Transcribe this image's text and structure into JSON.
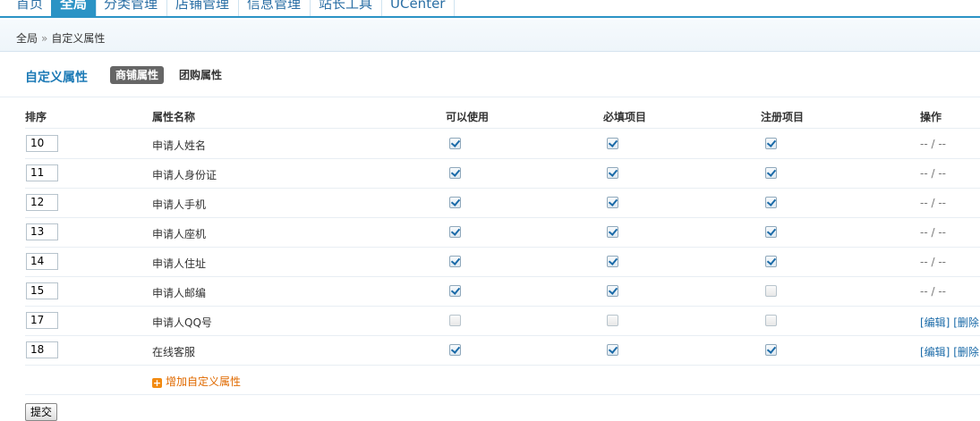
{
  "nav": {
    "tabs": [
      {
        "label": "首页"
      },
      {
        "label": "全局",
        "active": true
      },
      {
        "label": "分类管理"
      },
      {
        "label": "店铺管理"
      },
      {
        "label": "信息管理"
      },
      {
        "label": "站长工具"
      },
      {
        "label": "UCenter"
      }
    ]
  },
  "breadcrumb": {
    "root": "全局",
    "separator": "»",
    "current": "自定义属性"
  },
  "section": {
    "title": "自定义属性",
    "subtabs": [
      {
        "label": "商铺属性",
        "active": true
      },
      {
        "label": "团购属性"
      }
    ]
  },
  "table": {
    "headers": {
      "order": "排序",
      "name": "属性名称",
      "usable": "可以使用",
      "required": "必填项目",
      "register": "注册项目",
      "action": "操作"
    },
    "rows": [
      {
        "order": "10",
        "name": "申请人姓名",
        "usable": true,
        "required": true,
        "register": true,
        "action": "-- / --"
      },
      {
        "order": "11",
        "name": "申请人身份证",
        "usable": true,
        "required": true,
        "register": true,
        "action": "-- / --"
      },
      {
        "order": "12",
        "name": "申请人手机",
        "usable": true,
        "required": true,
        "register": true,
        "action": "-- / --"
      },
      {
        "order": "13",
        "name": "申请人座机",
        "usable": true,
        "required": true,
        "register": true,
        "action": "-- / --"
      },
      {
        "order": "14",
        "name": "申请人住址",
        "usable": true,
        "required": true,
        "register": true,
        "action": "-- / --"
      },
      {
        "order": "15",
        "name": "申请人邮编",
        "usable": true,
        "required": true,
        "register": false,
        "action": "-- / --"
      },
      {
        "order": "17",
        "name": "申请人QQ号",
        "usable": false,
        "required": false,
        "register": false,
        "edit": "[编辑]",
        "delete": "[删除"
      },
      {
        "order": "18",
        "name": "在线客服",
        "usable": true,
        "required": true,
        "register": true,
        "edit": "[编辑]",
        "delete": "[删除"
      }
    ],
    "add_label": "增加自定义属性"
  },
  "submit_label": "提交",
  "colors": {
    "accent": "#2b93c5",
    "link": "#1a6aa8",
    "add": "#e06a00"
  }
}
